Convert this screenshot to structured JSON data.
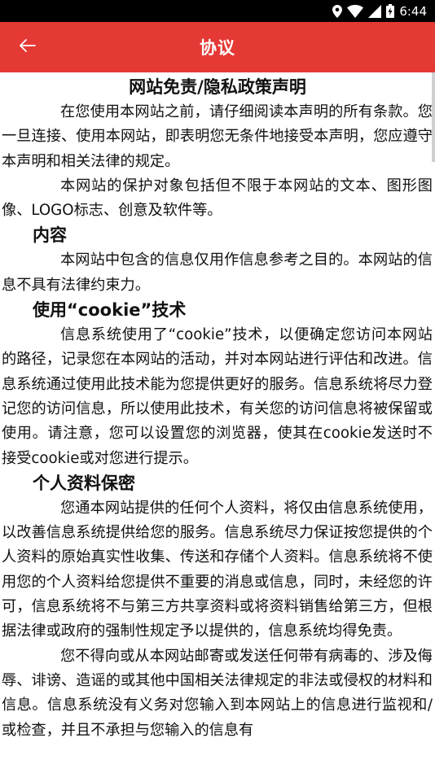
{
  "status_bar": {
    "time": "6:44",
    "icons": [
      "location-icon",
      "wifi-icon",
      "signal-icon",
      "battery-icon"
    ]
  },
  "app_bar": {
    "title": "协议",
    "back_icon": "arrow-left-icon",
    "background": "#e53935"
  },
  "document": {
    "title": "网站免责/隐私政策声明",
    "intro_paragraphs": [
      "在您使用本网站之前，请仔细阅读本声明的所有条款。您一旦连接、使用本网站，即表明您无条件地接受本声明，您应遵守本声明和相关法律的规定。",
      "本网站的保护对象包括但不限于本网站的文本、图形图像、LOGO标志、创意及软件等。"
    ],
    "sections": [
      {
        "heading": "内容",
        "paragraphs": [
          "本网站中包含的信息仅用作信息参考之目的。本网站的信息不具有法律约束力。"
        ]
      },
      {
        "heading": "使用“cookie”技术",
        "paragraphs": [
          "信息系统使用了“cookie”技术，以便确定您访问本网站的路径，记录您在本网站的活动，并对本网站进行评估和改进。信息系统通过使用此技术能为您提供更好的服务。信息系统将尽力登记您的访问信息，所以使用此技术，有关您的访问信息将被保留或使用。请注意，您可以设置您的浏览器，使其在cookie发送时不接受cookie或对您进行提示。"
        ]
      },
      {
        "heading": "个人资料保密",
        "paragraphs": [
          "您通本网站提供的任何个人资料，将仅由信息系统使用，以改善信息系统提供给您的服务。信息系统尽力保证按您提供的个人资料的原始真实性收集、传送和存储个人资料。信息系统将不使用您的个人资料给您提供不重要的消息或信息，同时，未经您的许可，信息系统将不与第三方共享资料或将资料销售给第三方，但根据法律或政府的强制性规定予以提供的，信息系统均得免责。",
          "您不得向或从本网站邮寄或发送任何带有病毒的、涉及侮辱、诽谤、造谣的或其他中国相关法律规定的非法或侵权的材料和信息。信息系统没有义务对您输入到本网站上的信息进行监视和/或检查，并且不承担与您输入的信息有"
        ]
      }
    ]
  }
}
